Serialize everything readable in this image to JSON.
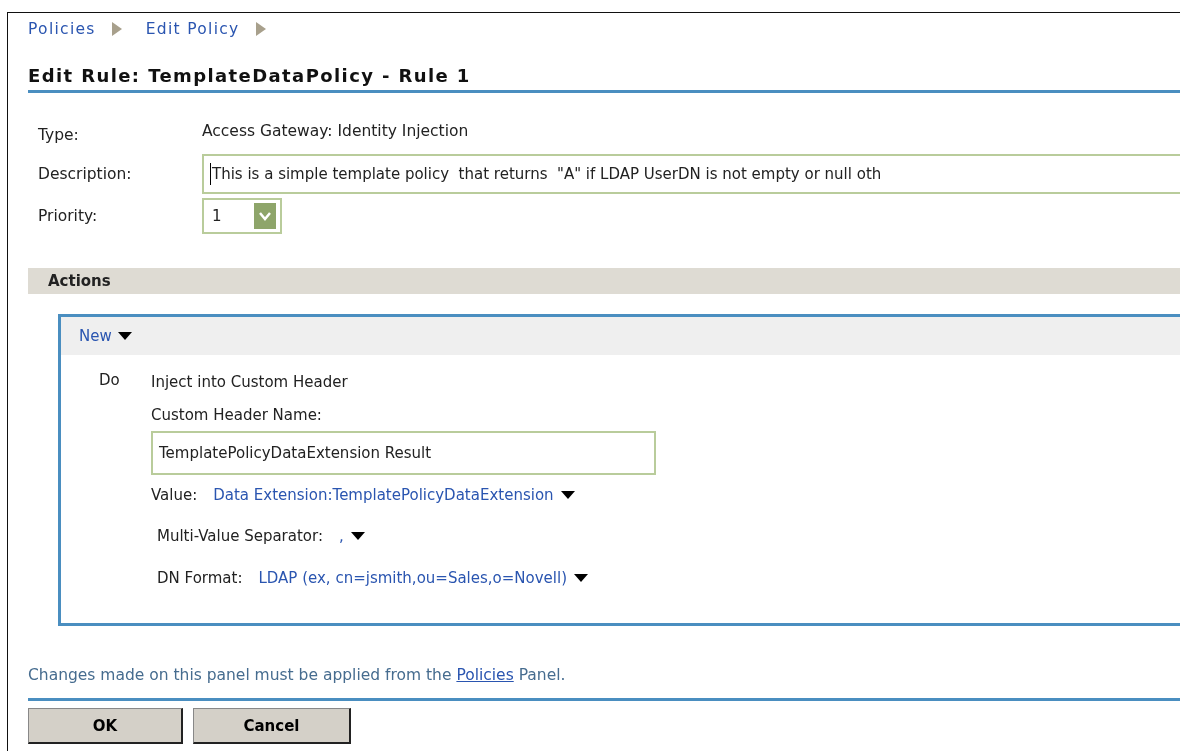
{
  "breadcrumb": [
    "Policies",
    "Edit Policy"
  ],
  "title": "Edit Rule: TemplateDataPolicy - Rule 1",
  "fields": [
    {
      "kind": "text",
      "label": "Type:",
      "value": "Access Gateway: Identity Injection"
    },
    {
      "kind": "input",
      "label": "Description:",
      "value": "This is a simple template policy  that returns  \"A\" if LDAP UserDN is not empty or null oth"
    },
    {
      "kind": "select",
      "label": "Priority:",
      "value": "1"
    }
  ],
  "actions": {
    "title": "Actions",
    "menu": "New",
    "do_label": "Do",
    "action": "Inject into Custom Header",
    "header_name_label": "Custom Header Name:",
    "header_name": "TemplatePolicyDataExtension Result",
    "options": [
      {
        "label": "Value:",
        "value": "Data Extension:TemplatePolicyDataExtension"
      },
      {
        "label": "Multi-Value Separator:",
        "value": ","
      },
      {
        "label": "DN Format:",
        "value": "LDAP (ex, cn=jsmith,ou=Sales,o=Novell)"
      }
    ]
  },
  "note": {
    "before": "Changes made on this panel must be applied from the ",
    "link": "Policies",
    "after": " Panel."
  },
  "buttons": [
    "OK",
    "Cancel"
  ]
}
